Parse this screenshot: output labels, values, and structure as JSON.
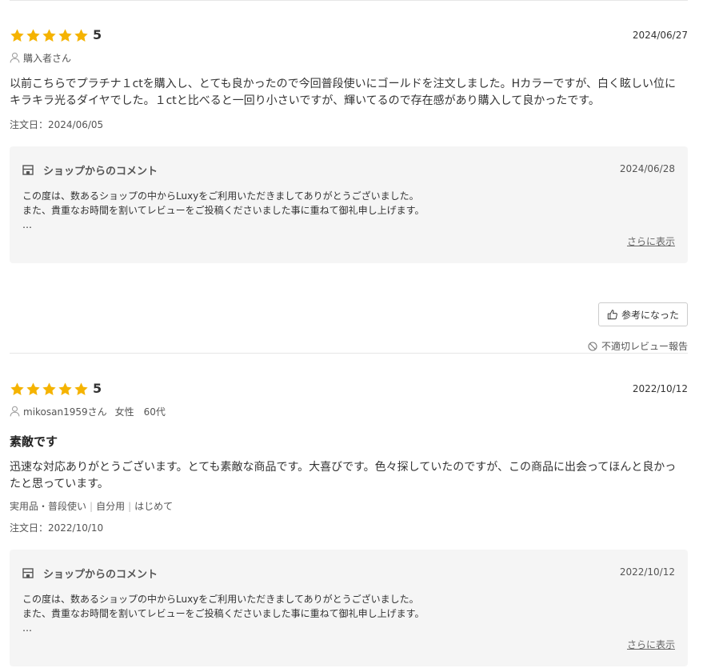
{
  "reviews": [
    {
      "rating": "5",
      "stars": 5,
      "date": "2024/06/27",
      "reviewer": "購入者さん",
      "meta": "",
      "body_lines": [
        "以前こちらでプラチナ１ctを購入し、とても良かったので今回普段使いにゴールドを注文しました。Hカラーですが、白く眩しい位に",
        "キラキラ光るダイヤでした。１ctと比べると一回り小さいですが、輝いてるので存在感があり購入して良かったです。"
      ],
      "order_date": "注文日：2024/06/05",
      "shop_comment": {
        "heading": "ショップからのコメント",
        "date": "2024/06/28",
        "lines": [
          "この度は、数あるショップの中からLuxyをご利用いただきましてありがとうございました。",
          "また、貴重なお時間を割いてレビューをご投稿くださいました事に重ねて御礼申し上げます。",
          "…"
        ],
        "more": "さらに表示"
      },
      "helpful": "参考になった",
      "report": "不適切レビュー報告"
    },
    {
      "rating": "5",
      "stars": 5,
      "date": "2022/10/12",
      "reviewer": "mikosan1959さん",
      "meta": "女性　60代",
      "title": "素敵です",
      "body_lines": [
        "迅速な対応ありがとうございます。とても素敵な商品です。大喜びです。色々探していたのですが、この商品に出会ってほんと良かっ",
        "たと思っています。"
      ],
      "tags": [
        "実用品・普段使い",
        "自分用",
        "はじめて"
      ],
      "order_date": "注文日：2022/10/10",
      "shop_comment": {
        "heading": "ショップからのコメント",
        "date": "2022/10/12",
        "lines": [
          "この度は、数あるショップの中からLuxyをご利用いただきましてありがとうございました。",
          "また、貴重なお時間を割いてレビューをご投稿くださいました事に重ねて御礼申し上げます。",
          "…"
        ],
        "more": "さらに表示"
      }
    }
  ],
  "colors": {
    "star": "#f5b301",
    "box_bg": "#f5f5f5"
  },
  "icons": [
    "star-icon",
    "user-icon",
    "shop-icon",
    "thumbs-up-icon",
    "prohibited-icon"
  ]
}
